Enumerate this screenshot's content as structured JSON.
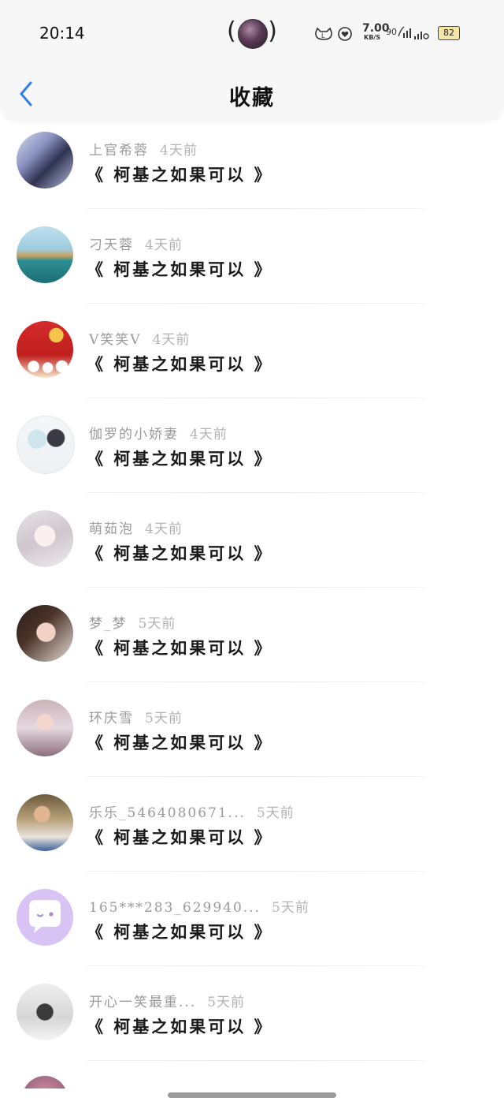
{
  "status_bar": {
    "time": "20:14",
    "speed": "7.00",
    "speed_unit": "KB/S",
    "battery": "82",
    "icons": [
      "cat-icon",
      "heart-icon",
      "hd-icon",
      "wifi-icon",
      "signal-icon"
    ]
  },
  "header": {
    "title": "收藏",
    "back_icon": "chevron-left-icon",
    "accent": "#2f7fe6"
  },
  "items": [
    {
      "username": "上官希蓉",
      "time": "4天前",
      "title": "《 柯基之如果可以 》"
    },
    {
      "username": "刁天蓉",
      "time": "4天前",
      "title": "《 柯基之如果可以 》"
    },
    {
      "username": "V笑笑V",
      "time": "4天前",
      "title": "《 柯基之如果可以 》"
    },
    {
      "username": "伽罗的小娇妻",
      "time": "4天前",
      "title": "《 柯基之如果可以 》"
    },
    {
      "username": "萌茹泡",
      "time": "4天前",
      "title": "《 柯基之如果可以 》"
    },
    {
      "username": "梦_梦",
      "time": "5天前",
      "title": "《 柯基之如果可以 》"
    },
    {
      "username": "环庆雪",
      "time": "5天前",
      "title": "《 柯基之如果可以 》"
    },
    {
      "username": "乐乐_5464080671...",
      "time": "5天前",
      "title": "《 柯基之如果可以 》"
    },
    {
      "username": "165***283_629940...",
      "time": "5天前",
      "title": "《 柯基之如果可以 》"
    },
    {
      "username": "开心一笑最重...",
      "time": "5天前",
      "title": "《 柯基之如果可以 》"
    }
  ]
}
